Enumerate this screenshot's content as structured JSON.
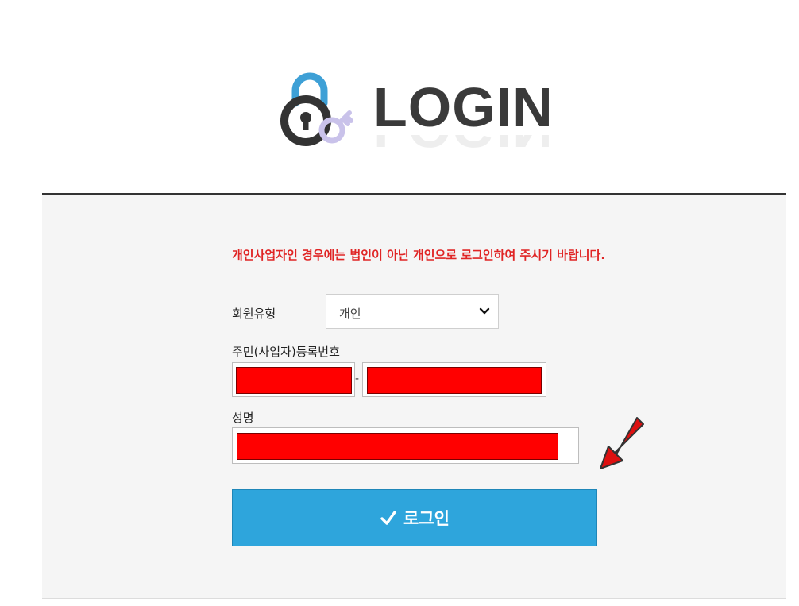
{
  "header": {
    "title": "LOGIN",
    "logo_icon": "padlock-key-icon"
  },
  "form": {
    "notice": "개인사업자인 경우에는 법인이 아닌 개인으로 로그인하여 주시기 바랍니다.",
    "member_type_label": "회원유형",
    "member_type_value": "개인",
    "reg_number_label": "주민(사업자)등록번호",
    "reg_separator": "-",
    "name_label": "성명",
    "login_button_label": "로그인",
    "login_button_icon": "checkmark-icon"
  },
  "annotation": {
    "arrow_icon": "red-pointer-arrow-icon",
    "redaction_color": "#ff0000"
  },
  "colors": {
    "accent": "#2ea5dc",
    "notice": "#e02525",
    "logo_blue": "#3ea0d6",
    "logo_key": "#c9c2ea"
  }
}
